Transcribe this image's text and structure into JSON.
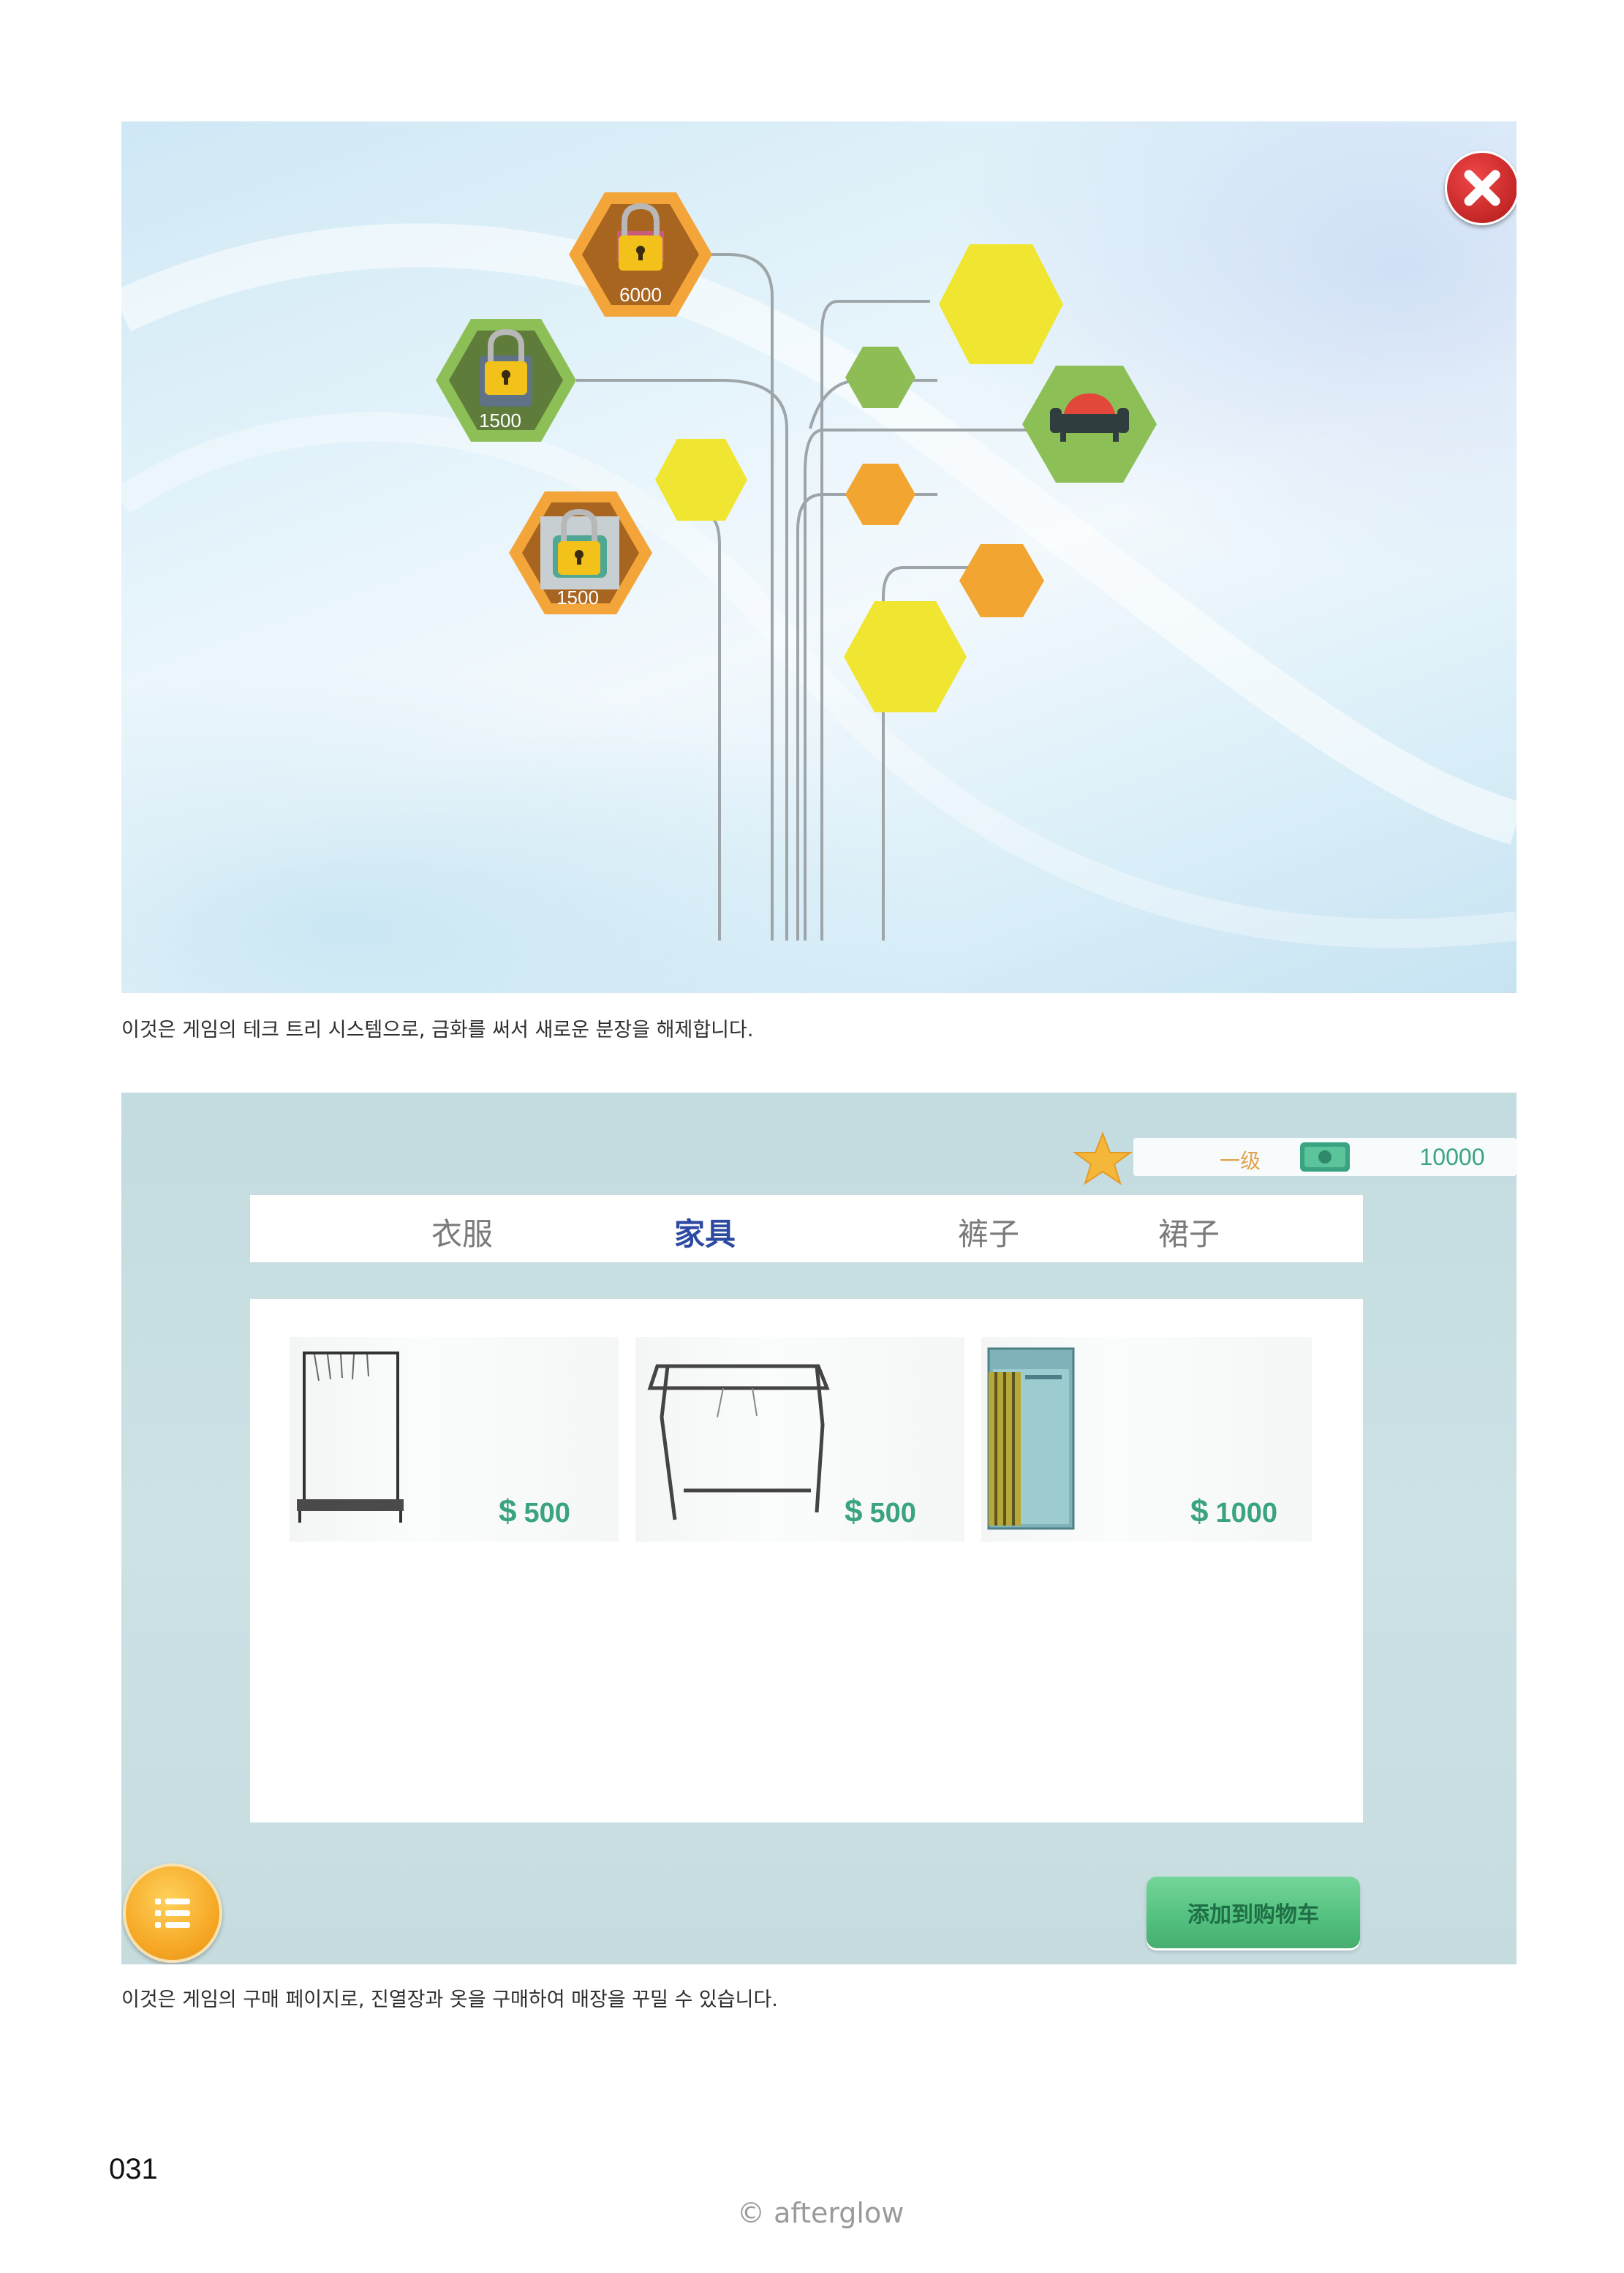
{
  "tech_tree": {
    "nodes": [
      {
        "state": "locked",
        "cost": "6000",
        "color": "#f0a033",
        "icon": "lock-icon"
      },
      {
        "state": "locked",
        "cost": "1500",
        "color": "#8bbd54",
        "icon": "lock-icon"
      },
      {
        "state": "locked",
        "cost": "1500",
        "color": "#f0a033",
        "icon": "lock-icon"
      },
      {
        "state": "unlocked",
        "color": "#8bbd54",
        "icon": "sofa-icon"
      }
    ],
    "close_icon": "close-icon"
  },
  "captions": {
    "tech_tree": "이것은 게임의 테크 트리 시스템으로, 금화를 써서 새로운 분장을 해제합니다.",
    "shop": "이것은 게임의 구매 페이지로, 진열장과 옷을 구매하여 매장을 꾸밀 수 있습니다."
  },
  "shop": {
    "level": "一级",
    "money": "10000",
    "tabs": [
      {
        "label": "衣服",
        "active": false
      },
      {
        "label": "家具",
        "active": true
      },
      {
        "label": "裤子",
        "active": false
      },
      {
        "label": "裙子",
        "active": false
      }
    ],
    "products": [
      {
        "name": "coat-rack-with-bench",
        "currency": "$",
        "price": "500"
      },
      {
        "name": "clothes-drying-rack",
        "currency": "$",
        "price": "500"
      },
      {
        "name": "fitting-room",
        "currency": "$",
        "price": "1000"
      }
    ],
    "add_to_cart_label": "添加到购物车",
    "colors": {
      "price": "#3aa381",
      "active_tab": "#2d4aa3",
      "cart_button": "#52c07f"
    }
  },
  "footer": {
    "page_number": "031",
    "brand": "© afterglow"
  }
}
